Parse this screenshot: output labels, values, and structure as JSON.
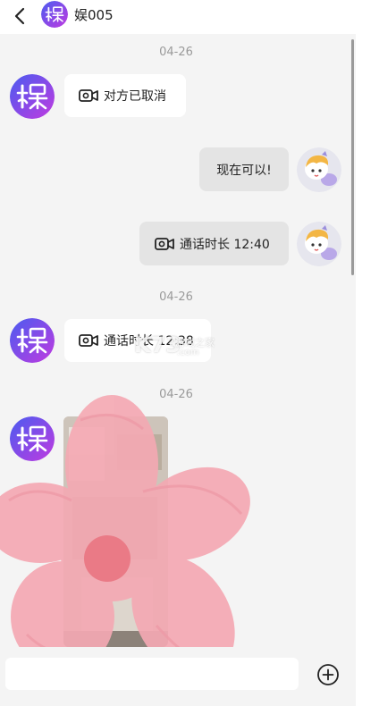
{
  "header": {
    "contact_name": "娱005",
    "avatar_icon": "yu-logo-avatar",
    "back_icon": "back-arrow-icon"
  },
  "messages": [
    {
      "type": "timestamp",
      "text": "04-26"
    },
    {
      "type": "call",
      "side": "incoming",
      "text": "对方已取消",
      "icon": "video-call-icon"
    },
    {
      "type": "text",
      "side": "outgoing",
      "text": "现在可以!"
    },
    {
      "type": "call",
      "side": "outgoing",
      "text": "通话时长 12:40",
      "icon": "video-call-icon"
    },
    {
      "type": "timestamp",
      "text": "04-26"
    },
    {
      "type": "call",
      "side": "incoming",
      "text": "通话时长 12:38",
      "icon": "video-call-icon"
    },
    {
      "type": "timestamp",
      "text": "04-26"
    },
    {
      "type": "image",
      "side": "incoming"
    }
  ],
  "watermark": {
    "main": "K73",
    "sub": "游戏之家",
    "domain": ".com"
  },
  "input": {
    "value": "",
    "placeholder": "",
    "plus_icon": "add-circle-icon"
  },
  "colors": {
    "avatar_gradient_start": "#4a5cf0",
    "avatar_gradient_end": "#c03ae0",
    "bubble_incoming": "#ffffff",
    "bubble_outgoing": "#e4e4e4",
    "background": "#f4f4f4",
    "flower_pink": "#f4a9b3"
  }
}
